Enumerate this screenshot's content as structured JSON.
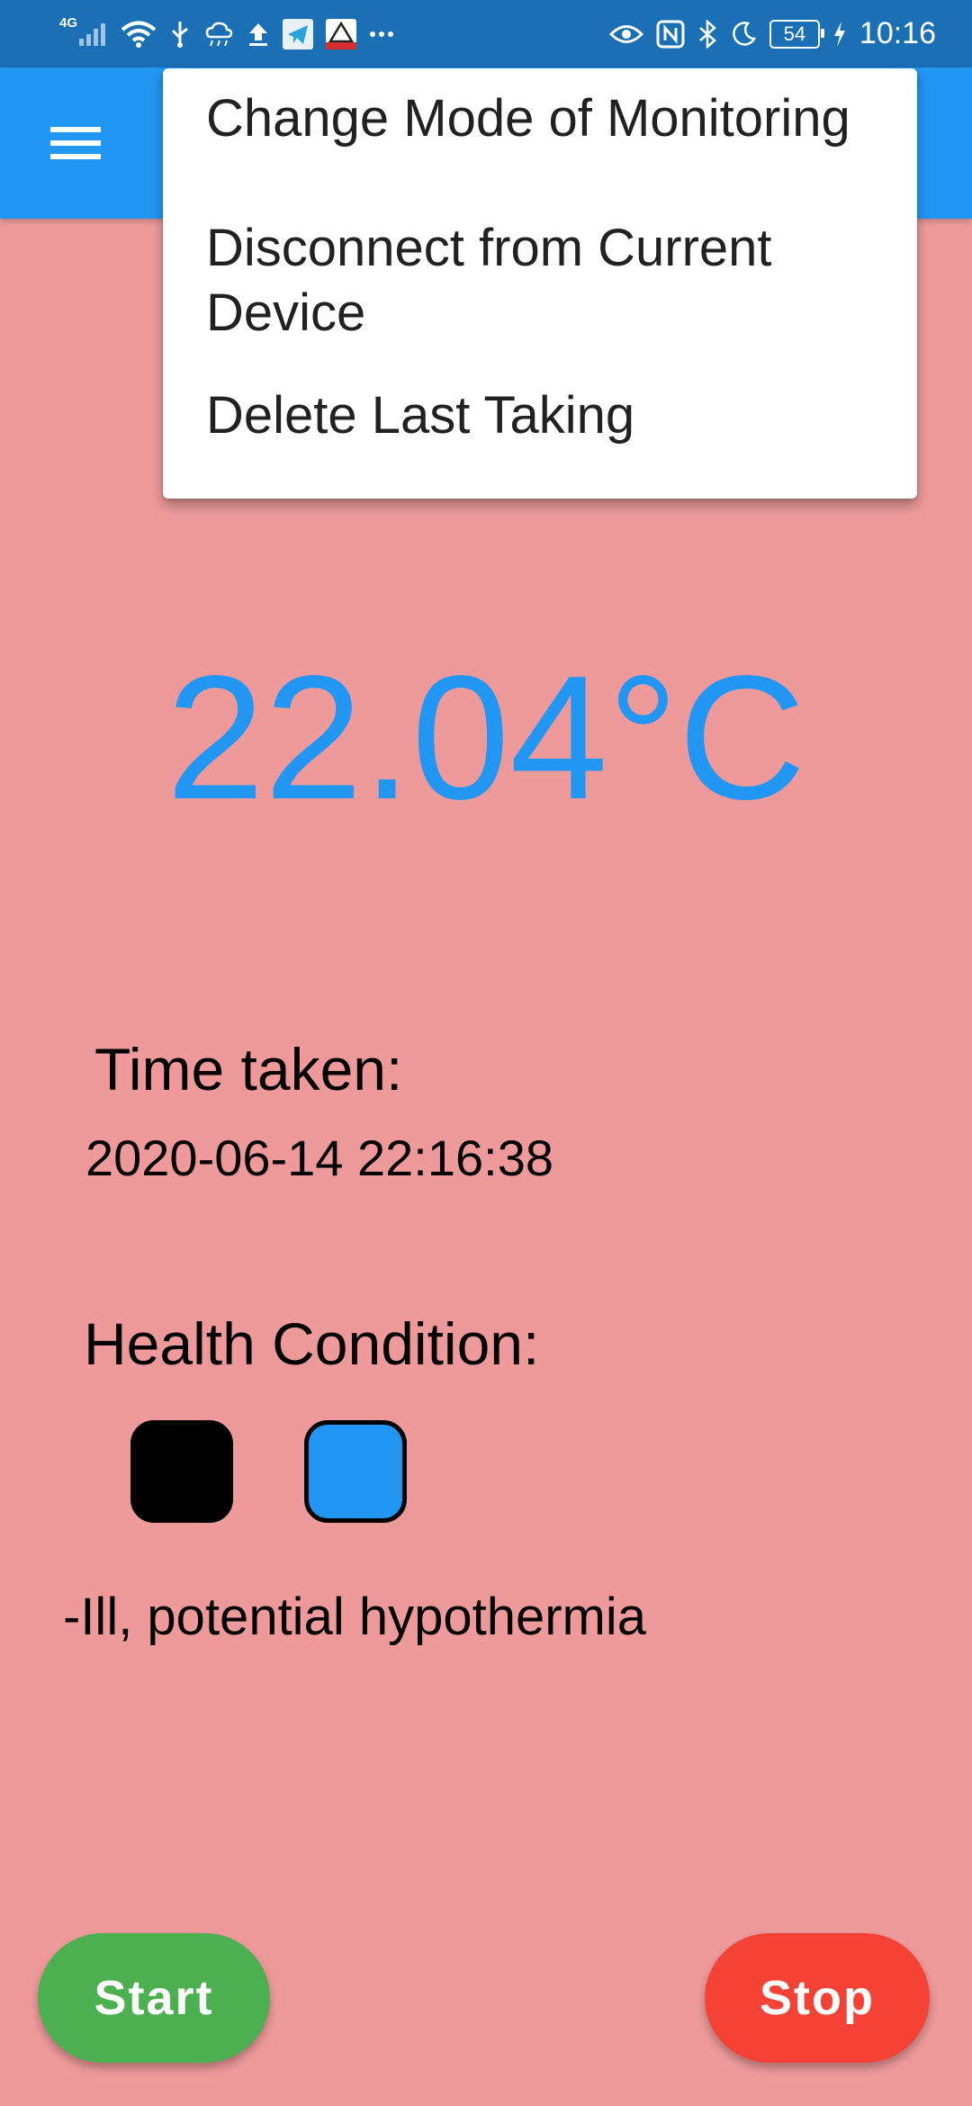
{
  "status_bar": {
    "network_label": "4G",
    "battery_level": "54",
    "time": "10:16",
    "icons_left": [
      "signal-icon",
      "wifi-icon",
      "usb-icon",
      "weather-icon",
      "upload-icon",
      "telegram-icon",
      "app-icon",
      "more-icon"
    ],
    "icons_right": [
      "eye-icon",
      "nfc-icon",
      "bluetooth-icon",
      "moon-icon",
      "battery-icon",
      "charging-icon"
    ]
  },
  "app_bar": {
    "color": "#2196f3",
    "menu_icon": "hamburger-menu-icon"
  },
  "popup_menu": {
    "items": [
      {
        "label": "Change Mode of Monitoring"
      },
      {
        "label": "Disconnect from Current Device"
      },
      {
        "label": "Delete Last Taking"
      }
    ]
  },
  "reading": {
    "temperature": "22.04°C",
    "time_label": "Time taken:",
    "time_value": "2020-06-14 22:16:38",
    "health_label": "Health Condition:",
    "condition_colors": [
      "#000000",
      "#2196f3"
    ],
    "condition_text": "-Ill, potential hypothermia"
  },
  "actions": {
    "start_label": "Start",
    "stop_label": "Stop",
    "start_color": "#4caf50",
    "stop_color": "#f44336"
  },
  "colors": {
    "background": "#ee9a9b",
    "status_bar": "#1b6fb5",
    "accent": "#2196f3"
  }
}
